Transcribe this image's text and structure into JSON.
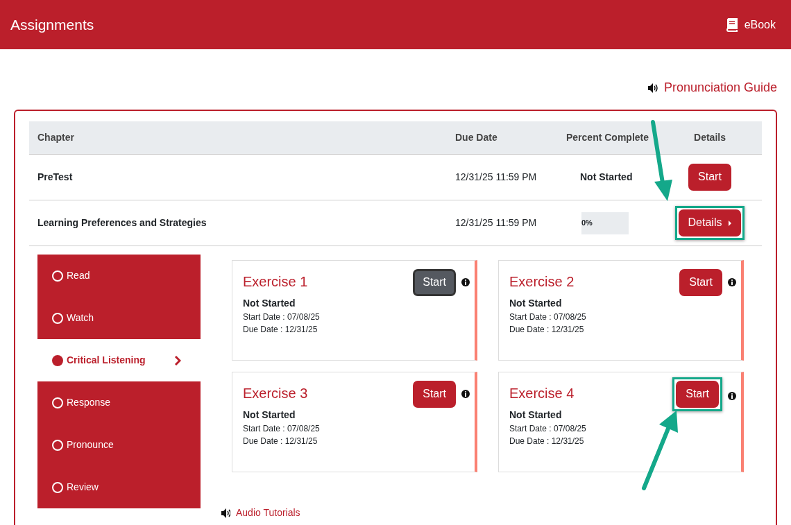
{
  "header": {
    "title": "Assignments",
    "ebook_label": "eBook"
  },
  "pronunciation_link": "Pronunciation Guide",
  "table": {
    "columns": [
      "Chapter",
      "Due Date",
      "Percent Complete",
      "Details"
    ],
    "rows": [
      {
        "chapter": "PreTest",
        "due": "12/31/25 11:59 PM",
        "kind": "text",
        "status": "Not Started",
        "action": {
          "label": "Start",
          "kind": "start",
          "highlighted": false
        }
      },
      {
        "chapter": "Learning Preferences and Strategies",
        "due": "12/31/25 11:59 PM",
        "kind": "progress",
        "status": "0%",
        "level": 0,
        "action": {
          "label": "Details",
          "kind": "details",
          "highlighted": true
        }
      }
    ]
  },
  "steps": [
    {
      "label": "Read",
      "selected": false
    },
    {
      "label": "Watch",
      "selected": false
    },
    {
      "label": "Critical Listening",
      "selected": true
    },
    {
      "label": "Response",
      "selected": false
    },
    {
      "label": "Pronounce",
      "selected": false
    },
    {
      "label": "Review",
      "selected": false
    }
  ],
  "exercises": [
    {
      "title": "Exercise 1",
      "status": "Not Started",
      "start_date": "Start Date : 07/08/25",
      "due_date": "Due Date : 12/31/25",
      "button": "Start",
      "focused": true,
      "highlighted": false
    },
    {
      "title": "Exercise 2",
      "status": "Not Started",
      "start_date": "Start Date : 07/08/25",
      "due_date": "Due Date : 12/31/25",
      "button": "Start",
      "focused": false,
      "highlighted": false
    },
    {
      "title": "Exercise 3",
      "status": "Not Started",
      "start_date": "Start Date : 07/08/25",
      "due_date": "Due Date : 12/31/25",
      "button": "Start",
      "focused": false,
      "highlighted": false
    },
    {
      "title": "Exercise 4",
      "status": "Not Started",
      "start_date": "Start Date : 07/08/25",
      "due_date": "Due Date : 12/31/25",
      "button": "Start",
      "focused": false,
      "highlighted": true
    }
  ],
  "audio_link": "Audio Tutorials"
}
